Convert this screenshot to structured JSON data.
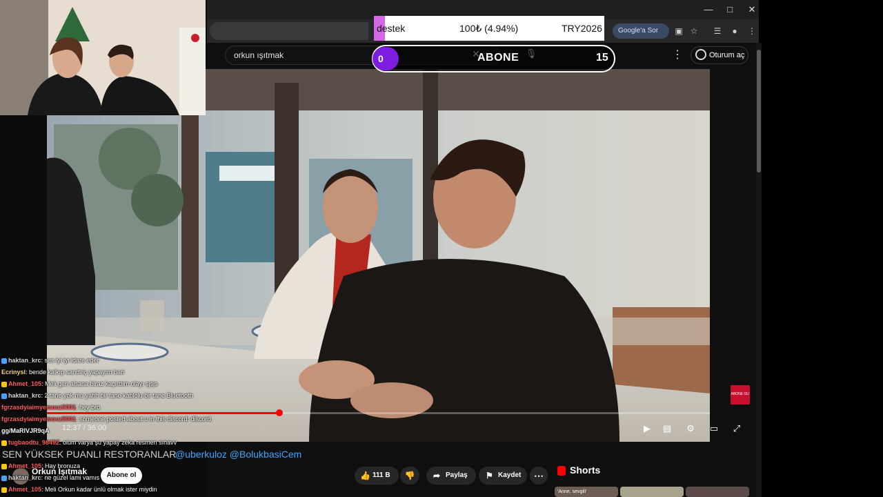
{
  "browser": {
    "google_sor_label": "Google'a Sor",
    "window_controls": [
      "minimize-icon",
      "maximize-icon",
      "close-icon"
    ]
  },
  "youtube": {
    "search_value": "orkun ışıtmak",
    "signin_label": "Oturum aç"
  },
  "donation_overlay": {
    "label": "destek",
    "amount": "100₺ (4.94%)",
    "code": "TRY2026",
    "progress_fraction": 0.0494,
    "fill_color": "#d268e6"
  },
  "subscriber_goal": {
    "current": "0",
    "label": "ABONE",
    "target": "15",
    "accent_color": "#7c1de0"
  },
  "player": {
    "timecode": "12:37 / 36:00",
    "progress_fraction": 0.351,
    "progress_color": "#ff0000",
    "controls": [
      "autoplay-toggle-icon",
      "captions-icon",
      "settings-icon",
      "theater-mode-icon",
      "fullscreen-icon"
    ],
    "sub_badge_text": "ABONE OL!"
  },
  "video_info": {
    "title_overlay": "SEN YÜKSEK PUANLI RESTORANLAR",
    "mentions": "@uberkuloz @BolukbasiCem",
    "channel_name": "Orkun Işıtmak",
    "subscribe_label": "Abone ol",
    "likes": "111 B",
    "share_label": "Paylaş",
    "save_label": "Kaydet"
  },
  "shorts": {
    "heading": "Shorts",
    "thumbs": [
      "'Anne, sevgili'",
      "",
      ""
    ]
  },
  "chat": [
    {
      "user": "haktan_krc",
      "text": ": ses iyi iyi idare eder",
      "color": "#d6d6d6",
      "badge": "#4aa3ff"
    },
    {
      "user": "Ecrinysl",
      "text": ": bende kalkıp sandviç yapayım bari",
      "color": "#f5d76e",
      "badge": ""
    },
    {
      "user": "Ahmet_105",
      "text": ": Meli geri alsana biraz kaçırdım olayı sjsjs",
      "color": "#ff5b5b",
      "badge": "#f5c518"
    },
    {
      "user": "haktan_krc",
      "text": ": 2 tane yok mu yahh bir tane kablolu bir tane Bluetooth",
      "color": "#d6d6d6",
      "badge": "#4aa3ff"
    },
    {
      "user": "fgrzasdyiaimyemocz9001",
      "text": ": hey bro",
      "color": "#ff5b5b",
      "badge": ""
    },
    {
      "user": "fgrzasdyiaimyemocz9001",
      "text": ": someone posted about u in this discord: discord.",
      "color": "#ff5b5b",
      "badge": ""
    },
    {
      "user": "gg/MaRIVJR9qA",
      "text": "",
      "color": "#ffffff",
      "badge": ""
    },
    {
      "user": "tugbaodtu_98492",
      "text": ": olum varya şu yapay zeka resmen sınavv",
      "color": "#ff5b5b",
      "badge": "#f5c518"
    },
    {
      "user": "",
      "text": "",
      "color": "#ffffff",
      "badge": ""
    },
    {
      "user": "Ahmet_105",
      "text": ": Hay bronuza",
      "color": "#ff5b5b",
      "badge": "#f5c518"
    },
    {
      "user": "haktan_krc",
      "text": ": ne güzel lami vamıs",
      "color": "#d6d6d6",
      "badge": "#4aa3ff"
    },
    {
      "user": "Ahmet_105",
      "text": ": Meli Orkun kadar ünlü olmak ister miydin",
      "color": "#ff5b5b",
      "badge": "#f5c518"
    }
  ]
}
